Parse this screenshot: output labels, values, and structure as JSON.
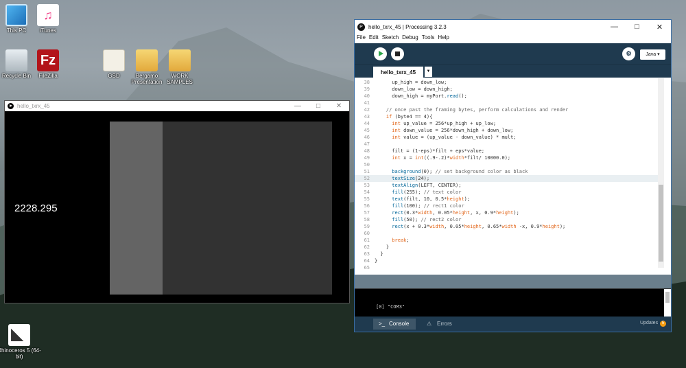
{
  "desktop": {
    "icons": [
      {
        "label": "This PC",
        "icon": "pc-icon"
      },
      {
        "label": "iTunes",
        "icon": "itunes-icon"
      },
      {
        "label": "Recycle Bin",
        "icon": "recycle-bin-icon"
      },
      {
        "label": "FileZilla",
        "icon": "filezilla-icon"
      },
      {
        "label": "GSD",
        "icon": "document-icon"
      },
      {
        "label": "Bergamo Presentation",
        "icon": "folder-icon"
      },
      {
        "label": "WORK SAMPLES",
        "icon": "folder-icon"
      },
      {
        "label": "Rhinoceros 5 (64-bit)",
        "icon": "rhino-icon"
      }
    ]
  },
  "sketch_window": {
    "title": "hello_txrx_45",
    "display_value": "2228.295"
  },
  "ide": {
    "title": "hello_txrx_45 | Processing 3.2.3",
    "menu": [
      "File",
      "Edit",
      "Sketch",
      "Debug",
      "Tools",
      "Help"
    ],
    "mode": "Java ▾",
    "tab": "hello_txrx_45",
    "tab_arrow": "▼",
    "code": [
      {
        "n": "38",
        "t": "      up_high = down_low;"
      },
      {
        "n": "39",
        "t": "      down_low = down_high;"
      },
      {
        "n": "40",
        "t": "      down_high = myPort.read();"
      },
      {
        "n": "41",
        "t": ""
      },
      {
        "n": "42",
        "t": "    // once past the framing bytes, perform calculations and render"
      },
      {
        "n": "43",
        "t": "    if (byte4 == 4){"
      },
      {
        "n": "44",
        "t": "      int up_value = 256*up_high + up_low;"
      },
      {
        "n": "45",
        "t": "      int down_value = 256*down_high + down_low;"
      },
      {
        "n": "46",
        "t": "      int value = (up_value - down_value) * mult;"
      },
      {
        "n": "47",
        "t": ""
      },
      {
        "n": "48",
        "t": "      filt = (1-eps)*filt + eps*value;"
      },
      {
        "n": "49",
        "t": "      int x = int((.9-.2)*width*filt/ 10000.0);"
      },
      {
        "n": "50",
        "t": ""
      },
      {
        "n": "51",
        "t": "      background(0); // set background color as black"
      },
      {
        "n": "52",
        "t": "      textSize(24);"
      },
      {
        "n": "53",
        "t": "      textAlign(LEFT, CENTER);"
      },
      {
        "n": "54",
        "t": "      fill(255); // text color"
      },
      {
        "n": "55",
        "t": "      text(filt, 10, 0.5*height);"
      },
      {
        "n": "56",
        "t": "      fill(100); // rect1 color"
      },
      {
        "n": "57",
        "t": "      rect(0.3*width, 0.05*height, x, 0.9*height);"
      },
      {
        "n": "58",
        "t": "      fill(50); // rect2 color"
      },
      {
        "n": "59",
        "t": "      rect(x + 0.3*width, 0.05*height, 0.65*width -x, 0.9*height);"
      },
      {
        "n": "60",
        "t": ""
      },
      {
        "n": "61",
        "t": "      break;"
      },
      {
        "n": "62",
        "t": "    }"
      },
      {
        "n": "63",
        "t": "  }"
      },
      {
        "n": "64",
        "t": "}"
      },
      {
        "n": "65",
        "t": ""
      }
    ],
    "highlight_line": "52",
    "console_output": "[0] \"COM3\"",
    "footer": {
      "console_label": "Console",
      "errors_label": "Errors",
      "updates_label": "Updates",
      "updates_count": "5"
    }
  }
}
